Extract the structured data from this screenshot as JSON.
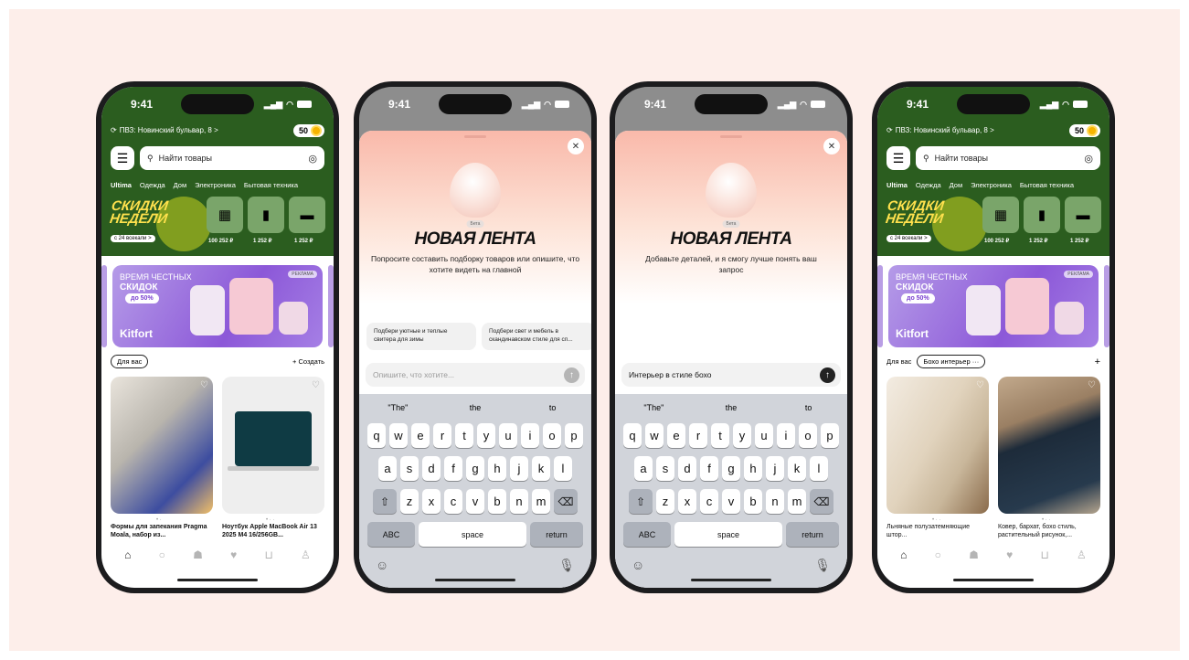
{
  "status": {
    "time": "9:41"
  },
  "shop": {
    "address": "ПВЗ: Новинский бульвар, 8 >",
    "coins": "50",
    "search_placeholder": "Найти товары",
    "categories": [
      "Ultima",
      "Одежда",
      "Дом",
      "Электроника",
      "Бытовая техника"
    ],
    "promo_title_line1": "СКИДКИ",
    "promo_title_line2": "НЕДЕЛИ",
    "promo_date": "с 24 всекали >",
    "deals": [
      {
        "price": "100 252 ₽",
        "icon": "diapers-pack-icon"
      },
      {
        "price": "1 252 ₽",
        "icon": "smartphone-icon"
      },
      {
        "price": "1 252 ₽",
        "icon": "sneaker-icon"
      }
    ],
    "banner": {
      "line1": "ВРЕМЯ ЧЕСТНЫХ",
      "line2": "СКИДОК",
      "pill": "до 50%",
      "brand": "Kitfort",
      "tag": "РЕКЛАМА"
    },
    "feed_tab": "Для вас",
    "create_label": "+ Создать",
    "products": [
      {
        "title": "Формы для запекания Pragma Moala, набор из..."
      },
      {
        "title": "Ноутбук Apple MacBook Air 13 2025 M4 16/256GB..."
      }
    ],
    "nav_icons": [
      "home-icon",
      "assistant-icon",
      "deals-icon",
      "favorites-icon",
      "cart-icon",
      "profile-icon"
    ]
  },
  "shop2": {
    "feed_tab": "Для вас",
    "custom_tab": "Бохо интерьер",
    "custom_tab_more": "···",
    "add_label": "+",
    "products": [
      {
        "title": "Льняные полузатемняющие штор..."
      },
      {
        "title": "Ковер, бархат, бохо стиль, растительный рисунок,..."
      }
    ]
  },
  "sheet1": {
    "beta": "Бета",
    "title": "НОВАЯ ЛЕНТА",
    "subtitle": "Попросите составить подборку товаров или опишите, что хотите видеть на главной",
    "suggestions": [
      "Подбери уютные и теплые свитера для зимы",
      "Подбери свет и мебель в скандинавском стиле для сп..."
    ],
    "input_placeholder": "Опишите, что хотите..."
  },
  "sheet2": {
    "beta": "Бета",
    "title": "НОВАЯ ЛЕНТА",
    "subtitle": "Добавьте деталей, и я смогу лучше понять ваш запрос",
    "input_value": "Интерьер в стиле бохо"
  },
  "keyboard": {
    "predictions": [
      "\"The\"",
      "the",
      "to"
    ],
    "row1": [
      "q",
      "w",
      "e",
      "r",
      "t",
      "y",
      "u",
      "i",
      "o",
      "p"
    ],
    "row2": [
      "a",
      "s",
      "d",
      "f",
      "g",
      "h",
      "j",
      "k",
      "l"
    ],
    "row3": [
      "z",
      "x",
      "c",
      "v",
      "b",
      "n",
      "m"
    ],
    "abc": "ABC",
    "space": "space",
    "return": "return"
  },
  "colors": {
    "brand_green": "#2b5d1f",
    "accent_yellow": "#ffe14d",
    "banner_purple": "#8c58d8"
  }
}
